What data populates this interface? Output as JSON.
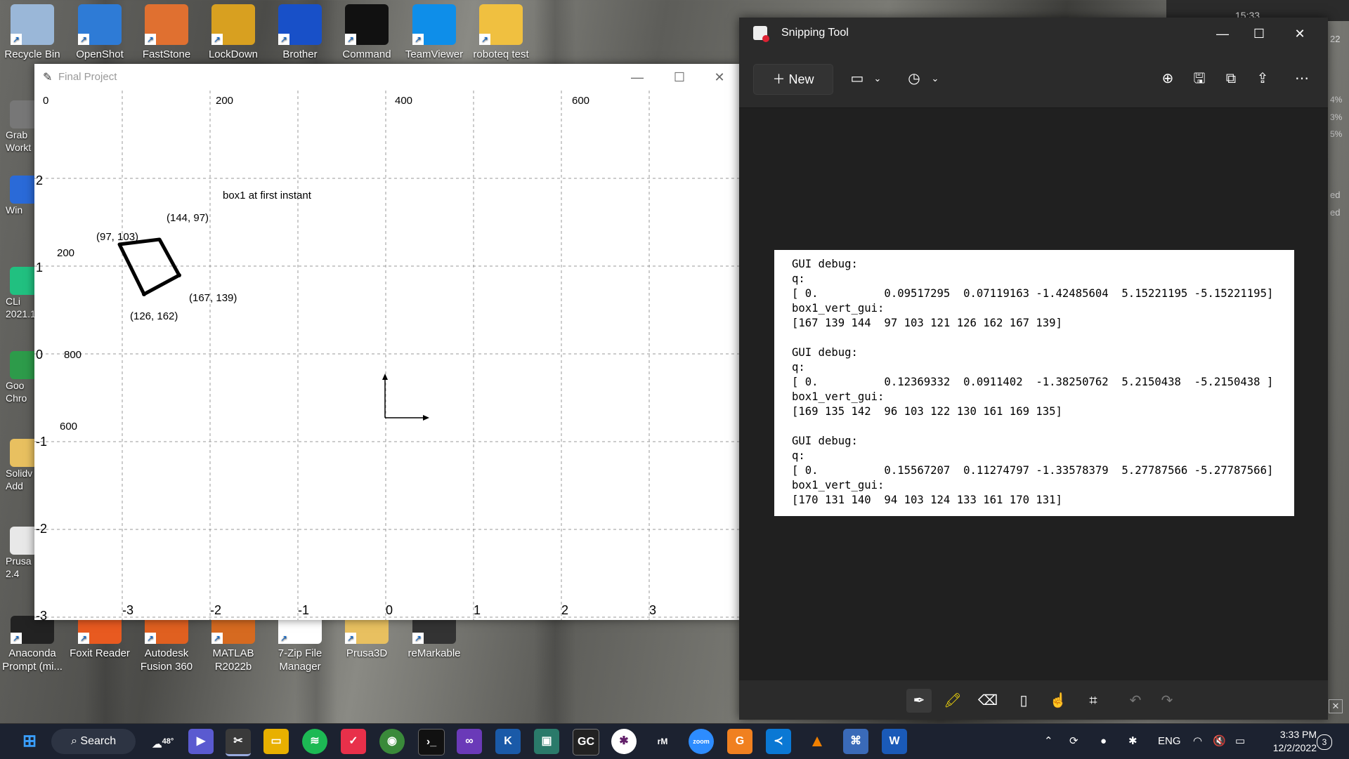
{
  "desktop": {
    "top_icons": [
      {
        "label": "Recycle Bin",
        "color": "#9ab7d8"
      },
      {
        "label": "OpenShot",
        "color": "#2e7bd6"
      },
      {
        "label": "FastStone",
        "color": "#e07030"
      },
      {
        "label": "LockDown",
        "color": "#d8a020"
      },
      {
        "label": "Brother",
        "color": "#1850c8"
      },
      {
        "label": "Command",
        "color": "#111111"
      },
      {
        "label": "TeamViewer",
        "color": "#0e8ee9"
      },
      {
        "label": "roboteq test",
        "color": "#f0c040"
      }
    ],
    "left_icons": [
      {
        "label": "Grab Workt",
        "color": "#777"
      },
      {
        "label": "Win",
        "color": "#2a6ad8"
      },
      {
        "label": "CLi 2021.1",
        "color": "#21c080"
      },
      {
        "label": "Goo Chro",
        "color": "#2d9b4a"
      },
      {
        "label": "Solidv Add",
        "color": "#e8c060"
      },
      {
        "label": "Prusa 2.4",
        "color": "#e8e8e8"
      }
    ],
    "bottom_icons": [
      {
        "label": "Anaconda Prompt (mi...",
        "color": "#222"
      },
      {
        "label": "Foxit Reader",
        "color": "#e85a20"
      },
      {
        "label": "Autodesk Fusion 360",
        "color": "#e06020"
      },
      {
        "label": "MATLAB R2022b",
        "color": "#d66a20"
      },
      {
        "label": "7-Zip File Manager",
        "color": "#ffffff"
      },
      {
        "label": "Prusa3D",
        "color": "#e8c060"
      },
      {
        "label": "reMarkable",
        "color": "#333"
      }
    ]
  },
  "final_project": {
    "title": "Final Project",
    "canvas": {
      "top_labels": [
        "0",
        "200",
        "400",
        "600"
      ],
      "left_pixel_labels": [
        "200",
        "800",
        "600"
      ],
      "y_ticks": [
        "2",
        "1",
        "0",
        "-1",
        "-2",
        "-3"
      ],
      "x_ticks": [
        "-3",
        "-2",
        "-1",
        "0",
        "1",
        "2",
        "3"
      ],
      "annotation": "box1 at first instant",
      "vertex_labels": [
        "(97, 103)",
        "(144, 97)",
        "(167, 139)",
        "(126, 162)"
      ]
    }
  },
  "snipping_tool": {
    "title": "Snipping Tool",
    "new_label": "New",
    "debug_text": "GUI debug:\nq:\n[ 0.          0.09517295  0.07119163 -1.42485604  5.15221195 -5.15221195]\nbox1_vert_gui:\n[167 139 144  97 103 121 126 162 167 139]\n\nGUI debug:\nq:\n[ 0.          0.12369332  0.0911402  -1.38250762  5.2150438  -5.2150438 ]\nbox1_vert_gui:\n[169 135 142  96 103 122 130 161 169 135]\n\nGUI debug:\nq:\n[ 0.          0.15567207  0.11274797 -1.33578379  5.27787566 -5.27787566]\nbox1_vert_gui:\n[170 131 140  94 103 124 133 161 170 131]"
  },
  "behind_window": {
    "time_fragment": "15:33",
    "percents": [
      "4%",
      "3%",
      "5%"
    ],
    "ed": [
      "ed",
      "ed"
    ],
    "num": "22"
  },
  "taskbar": {
    "search_label": "Search",
    "weather": "48°",
    "lang": "ENG",
    "time": "3:33 PM",
    "date": "12/2/2022",
    "notif_count": "3"
  }
}
